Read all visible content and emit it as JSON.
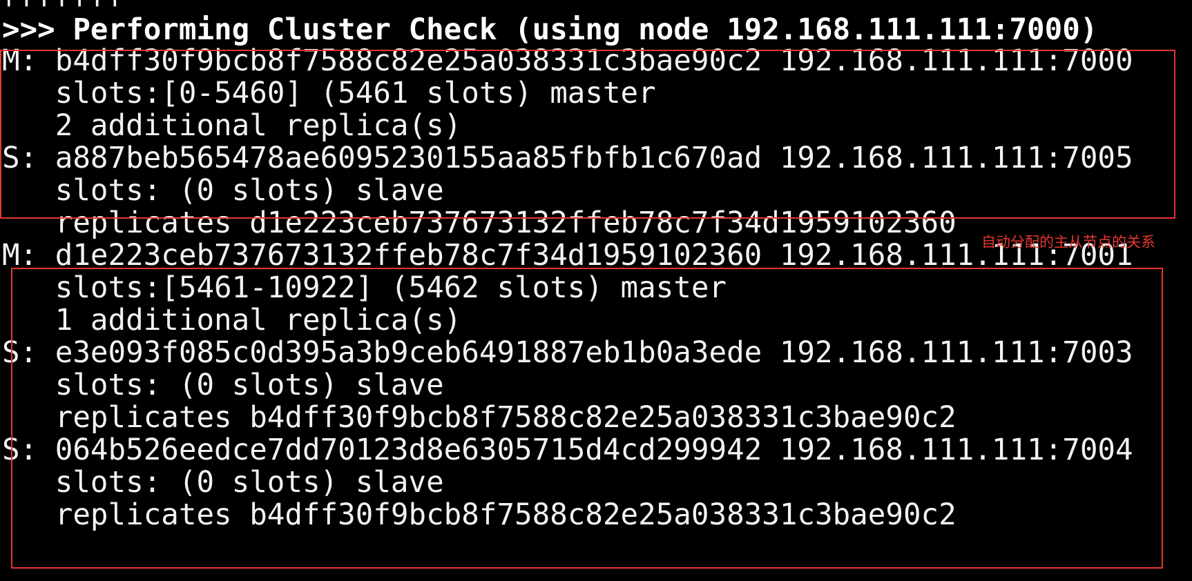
{
  "terminal": {
    "top_stub": "|||||||",
    "header": ">>> Performing Cluster Check (using node 192.168.111.111:7000)",
    "lines": [
      "M: b4dff30f9bcb8f7588c82e25a038331c3bae90c2 192.168.111.111:7000",
      "   slots:[0-5460] (5461 slots) master",
      "   2 additional replica(s)",
      "S: a887beb565478ae6095230155aa85fbfb1c670ad 192.168.111.111:7005",
      "   slots: (0 slots) slave",
      "   replicates d1e223ceb737673132ffeb78c7f34d1959102360",
      "M: d1e223ceb737673132ffeb78c7f34d1959102360 192.168.111.111:7001",
      "   slots:[5461-10922] (5462 slots) master",
      "   1 additional replica(s)",
      "S: e3e093f085c0d395a3b9ceb6491887eb1b0a3ede 192.168.111.111:7003",
      "   slots: (0 slots) slave",
      "   replicates b4dff30f9bcb8f7588c82e25a038331c3bae90c2",
      "S: 064b526eedce7dd70123d8e6305715d4cd299942 192.168.111.111:7004",
      "   slots: (0 slots) slave",
      "   replicates b4dff30f9bcb8f7588c82e25a038331c3bae90c2"
    ]
  },
  "annotation": {
    "text": "自动分配的主从节点的关系",
    "color": "#e8362f"
  },
  "colors": {
    "background": "#000000",
    "text": "#f2f2f2",
    "highlight_box": "#e8362f"
  }
}
